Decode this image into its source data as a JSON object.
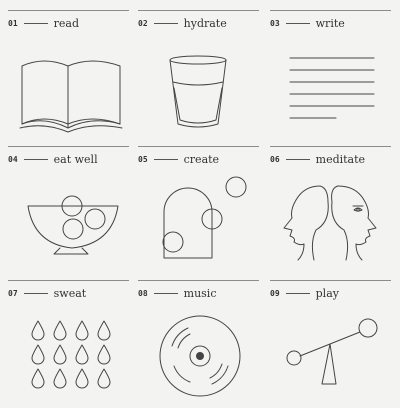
{
  "items": [
    {
      "num": "01",
      "word": "read",
      "icon": "open-book-icon"
    },
    {
      "num": "02",
      "word": "hydrate",
      "icon": "water-glass-icon"
    },
    {
      "num": "03",
      "word": "write",
      "icon": "text-lines-icon"
    },
    {
      "num": "04",
      "word": "eat well",
      "icon": "fruit-bowl-icon"
    },
    {
      "num": "05",
      "word": "create",
      "icon": "shapes-icon"
    },
    {
      "num": "06",
      "word": "meditate",
      "icon": "two-faces-icon"
    },
    {
      "num": "07",
      "word": "sweat",
      "icon": "sweat-drops-icon"
    },
    {
      "num": "08",
      "word": "music",
      "icon": "vinyl-record-icon"
    },
    {
      "num": "09",
      "word": "play",
      "icon": "seesaw-icon"
    }
  ]
}
